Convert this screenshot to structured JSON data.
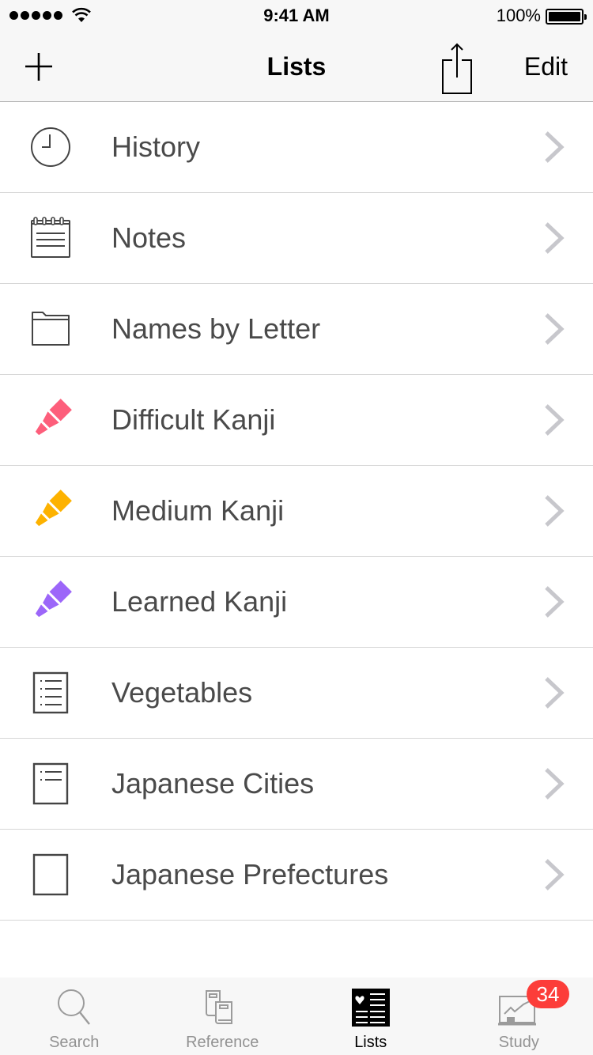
{
  "status_bar": {
    "time": "9:41 AM",
    "battery_percent": "100%",
    "signal_bars": 5
  },
  "nav_bar": {
    "title": "Lists",
    "add_icon": "plus-icon",
    "share_icon": "share-icon",
    "edit_label": "Edit"
  },
  "list": {
    "items": [
      {
        "label": "History",
        "icon": "clock-icon"
      },
      {
        "label": "Notes",
        "icon": "notepad-icon"
      },
      {
        "label": "Names by Letter",
        "icon": "folder-icon"
      },
      {
        "label": "Difficult Kanji",
        "icon": "highlighter-icon",
        "color": "#fd5e7b"
      },
      {
        "label": "Medium Kanji",
        "icon": "highlighter-icon",
        "color": "#fdb200"
      },
      {
        "label": "Learned Kanji",
        "icon": "highlighter-icon",
        "color": "#9c66f9"
      },
      {
        "label": "Vegetables",
        "icon": "list-document-icon"
      },
      {
        "label": "Japanese Cities",
        "icon": "short-list-document-icon"
      },
      {
        "label": "Japanese Prefectures",
        "icon": "blank-document-icon"
      }
    ]
  },
  "tab_bar": {
    "tabs": [
      {
        "label": "Search",
        "icon": "magnifier-icon",
        "active": false
      },
      {
        "label": "Reference",
        "icon": "books-icon",
        "active": false
      },
      {
        "label": "Lists",
        "icon": "lists-icon",
        "active": true
      },
      {
        "label": "Study",
        "icon": "study-chart-icon",
        "active": false,
        "badge": "34"
      }
    ]
  },
  "colors": {
    "badge": "#fc3d39",
    "difficult": "#fd5e7b",
    "medium": "#fdb200",
    "learned": "#9c66f9",
    "inactive_tab": "#929292"
  }
}
